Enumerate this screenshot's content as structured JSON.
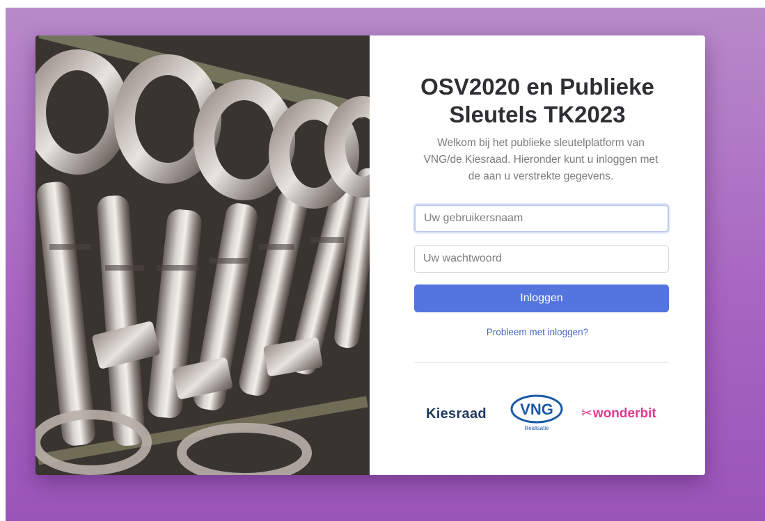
{
  "login": {
    "title": "OSV2020 en Publieke Sleutels TK2023",
    "subtitle": "Welkom bij het publieke sleutelplatform van VNG/de Kiesraad. Hieronder kunt u inloggen met de aan u verstrekte gegevens.",
    "username_placeholder": "Uw gebruikersnaam",
    "password_placeholder": "Uw wachtwoord",
    "submit_label": "Inloggen",
    "help_link": "Probleem met inloggen?"
  },
  "logos": {
    "kiesraad": "Kiesraad",
    "vng": "VNG",
    "vng_sub": "Realisatie",
    "wonderbit": "wonderbit"
  },
  "colors": {
    "background_gradient_top": "#b88ac9",
    "background_gradient_bottom": "#9a55b8",
    "button": "#5475dd",
    "link": "#4a66c9",
    "kiesraad_logo": "#1e3a5f",
    "vng_logo": "#1a5aa6",
    "wonderbit_logo": "#e6378e"
  },
  "icons": {
    "hero_image": "keys-photo"
  }
}
